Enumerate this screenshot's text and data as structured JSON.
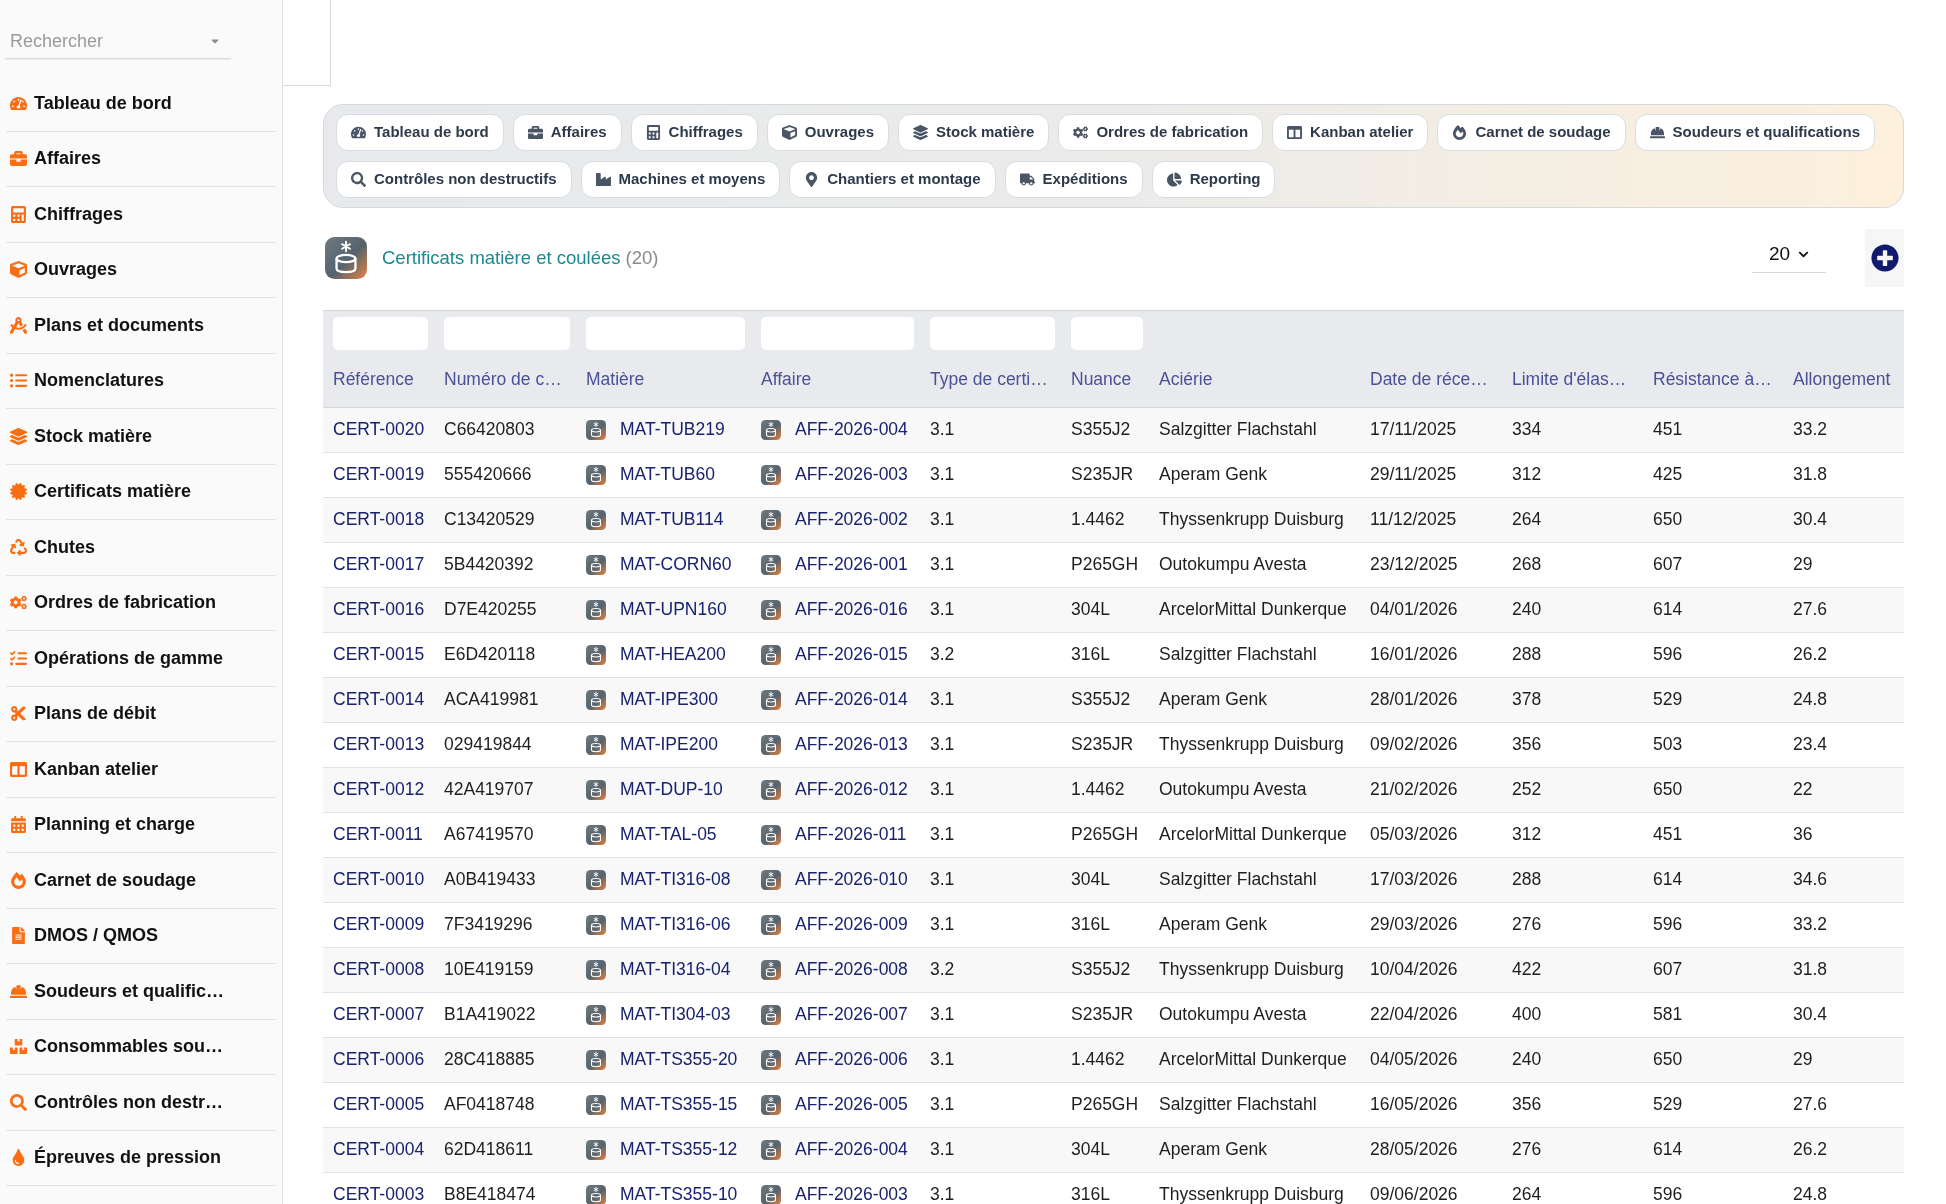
{
  "sidebar": {
    "search": {
      "placeholder": "Rechercher"
    },
    "items": [
      "Tableau de bord",
      "Affaires",
      "Chiffrages",
      "Ouvrages",
      "Plans et documents",
      "Nomenclatures",
      "Stock matière",
      "Certificats matière",
      "Chutes",
      "Ordres de fabrication",
      "Opérations de gamme",
      "Plans de débit",
      "Kanban atelier",
      "Planning et charge",
      "Carnet de soudage",
      "DMOS / QMOS",
      "Soudeurs et qualific…",
      "Consommables sou…",
      "Contrôles non destr…",
      "Épreuves de pression"
    ]
  },
  "nav_tab_rows": [
    [
      "Tableau de bord",
      "Affaires",
      "Chiffrages",
      "Ouvrages",
      "Stock matière",
      "Ordres de fabrication",
      "Kanban atelier",
      "Carnet de soudage",
      "Soudeurs et qualifications"
    ],
    [
      "Contrôles non destructifs",
      "Machines et moyens",
      "Chantiers et montage",
      "Expéditions",
      "Reporting"
    ]
  ],
  "header": {
    "title": "Certificats matière et coulées",
    "count": "(20)",
    "page_size": "20"
  },
  "table": {
    "columns": [
      {
        "label": "Référence",
        "kind": "link",
        "filter": true
      },
      {
        "label": "Numéro de c…",
        "kind": "text",
        "filter": true
      },
      {
        "label": "Matière",
        "kind": "icon_link",
        "filter": true
      },
      {
        "label": "Affaire",
        "kind": "icon_link",
        "filter": true
      },
      {
        "label": "Type de certi…",
        "kind": "text",
        "filter": true
      },
      {
        "label": "Nuance",
        "kind": "text",
        "filter": true
      },
      {
        "label": "Aciérie",
        "kind": "text",
        "filter": false
      },
      {
        "label": "Date de réce…",
        "kind": "text",
        "filter": false
      },
      {
        "label": "Limite d'élas…",
        "kind": "text",
        "filter": false
      },
      {
        "label": "Résistance à…",
        "kind": "text",
        "filter": false
      },
      {
        "label": "Allongement",
        "kind": "text",
        "filter": false
      }
    ],
    "rows": [
      [
        "CERT-0020",
        "C66420803",
        "MAT-TUB219",
        "AFF-2026-004",
        "3.1",
        "S355J2",
        "Salzgitter Flachstahl",
        "17/11/2025",
        "334",
        "451",
        "33.2"
      ],
      [
        "CERT-0019",
        "555420666",
        "MAT-TUB60",
        "AFF-2026-003",
        "3.1",
        "S235JR",
        "Aperam Genk",
        "29/11/2025",
        "312",
        "425",
        "31.8"
      ],
      [
        "CERT-0018",
        "C13420529",
        "MAT-TUB114",
        "AFF-2026-002",
        "3.1",
        "1.4462",
        "Thyssenkrupp Duisburg",
        "11/12/2025",
        "264",
        "650",
        "30.4"
      ],
      [
        "CERT-0017",
        "5B4420392",
        "MAT-CORN60",
        "AFF-2026-001",
        "3.1",
        "P265GH",
        "Outokumpu Avesta",
        "23/12/2025",
        "268",
        "607",
        "29"
      ],
      [
        "CERT-0016",
        "D7E420255",
        "MAT-UPN160",
        "AFF-2026-016",
        "3.1",
        "304L",
        "ArcelorMittal Dunkerque",
        "04/01/2026",
        "240",
        "614",
        "27.6"
      ],
      [
        "CERT-0015",
        "E6D420118",
        "MAT-HEA200",
        "AFF-2026-015",
        "3.2",
        "316L",
        "Salzgitter Flachstahl",
        "16/01/2026",
        "288",
        "596",
        "26.2"
      ],
      [
        "CERT-0014",
        "ACA419981",
        "MAT-IPE300",
        "AFF-2026-014",
        "3.1",
        "S355J2",
        "Aperam Genk",
        "28/01/2026",
        "378",
        "529",
        "24.8"
      ],
      [
        "CERT-0013",
        "029419844",
        "MAT-IPE200",
        "AFF-2026-013",
        "3.1",
        "S235JR",
        "Thyssenkrupp Duisburg",
        "09/02/2026",
        "356",
        "503",
        "23.4"
      ],
      [
        "CERT-0012",
        "42A419707",
        "MAT-DUP-10",
        "AFF-2026-012",
        "3.1",
        "1.4462",
        "Outokumpu Avesta",
        "21/02/2026",
        "252",
        "650",
        "22"
      ],
      [
        "CERT-0011",
        "A67419570",
        "MAT-TAL-05",
        "AFF-2026-011",
        "3.1",
        "P265GH",
        "ArcelorMittal Dunkerque",
        "05/03/2026",
        "312",
        "451",
        "36"
      ],
      [
        "CERT-0010",
        "A0B419433",
        "MAT-TI316-08",
        "AFF-2026-010",
        "3.1",
        "304L",
        "Salzgitter Flachstahl",
        "17/03/2026",
        "288",
        "614",
        "34.6"
      ],
      [
        "CERT-0009",
        "7F3419296",
        "MAT-TI316-06",
        "AFF-2026-009",
        "3.1",
        "316L",
        "Aperam Genk",
        "29/03/2026",
        "276",
        "596",
        "33.2"
      ],
      [
        "CERT-0008",
        "10E419159",
        "MAT-TI316-04",
        "AFF-2026-008",
        "3.2",
        "S355J2",
        "Thyssenkrupp Duisburg",
        "10/04/2026",
        "422",
        "607",
        "31.8"
      ],
      [
        "CERT-0007",
        "B1A419022",
        "MAT-TI304-03",
        "AFF-2026-007",
        "3.1",
        "S235JR",
        "Outokumpu Avesta",
        "22/04/2026",
        "400",
        "581",
        "30.4"
      ],
      [
        "CERT-0006",
        "28C418885",
        "MAT-TS355-20",
        "AFF-2026-006",
        "3.1",
        "1.4462",
        "ArcelorMittal Dunkerque",
        "04/05/2026",
        "240",
        "650",
        "29"
      ],
      [
        "CERT-0005",
        "AF0418748",
        "MAT-TS355-15",
        "AFF-2026-005",
        "3.1",
        "P265GH",
        "Salzgitter Flachstahl",
        "16/05/2026",
        "356",
        "529",
        "27.6"
      ],
      [
        "CERT-0004",
        "62D418611",
        "MAT-TS355-12",
        "AFF-2026-004",
        "3.1",
        "304L",
        "Aperam Genk",
        "28/05/2026",
        "276",
        "614",
        "26.2"
      ],
      [
        "CERT-0003",
        "B8E418474",
        "MAT-TS355-10",
        "AFF-2026-003",
        "3.1",
        "316L",
        "Thyssenkrupp Duisburg",
        "09/06/2026",
        "264",
        "596",
        "24.8"
      ]
    ]
  }
}
